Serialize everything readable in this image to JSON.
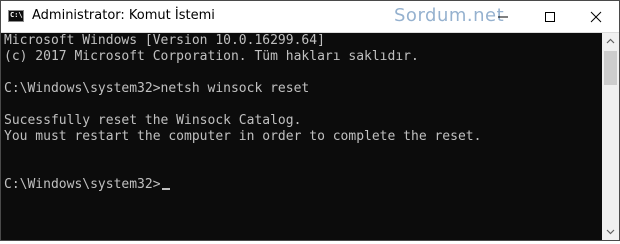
{
  "window": {
    "title": "Administrator: Komut İstemi",
    "icon_label": "C:\\",
    "watermark": "Sordum.net"
  },
  "controls": {
    "minimize_icon": "minimize-icon",
    "maximize_icon": "maximize-icon",
    "close_icon": "close-icon"
  },
  "console": {
    "lines": [
      "Microsoft Windows [Version 10.0.16299.64]",
      "(c) 2017 Microsoft Corporation. Tüm hakları saklıdır.",
      "",
      "C:\\Windows\\system32>netsh winsock reset",
      "",
      "Sucessfully reset the Winsock Catalog.",
      "You must restart the computer in order to complete the reset.",
      "",
      "",
      "C:\\Windows\\system32>"
    ]
  },
  "colors": {
    "console_background": "#0c0c0c",
    "console_text": "#c0c0c0",
    "titlebar_background": "#ffffff",
    "watermark": "#3f73a8"
  }
}
